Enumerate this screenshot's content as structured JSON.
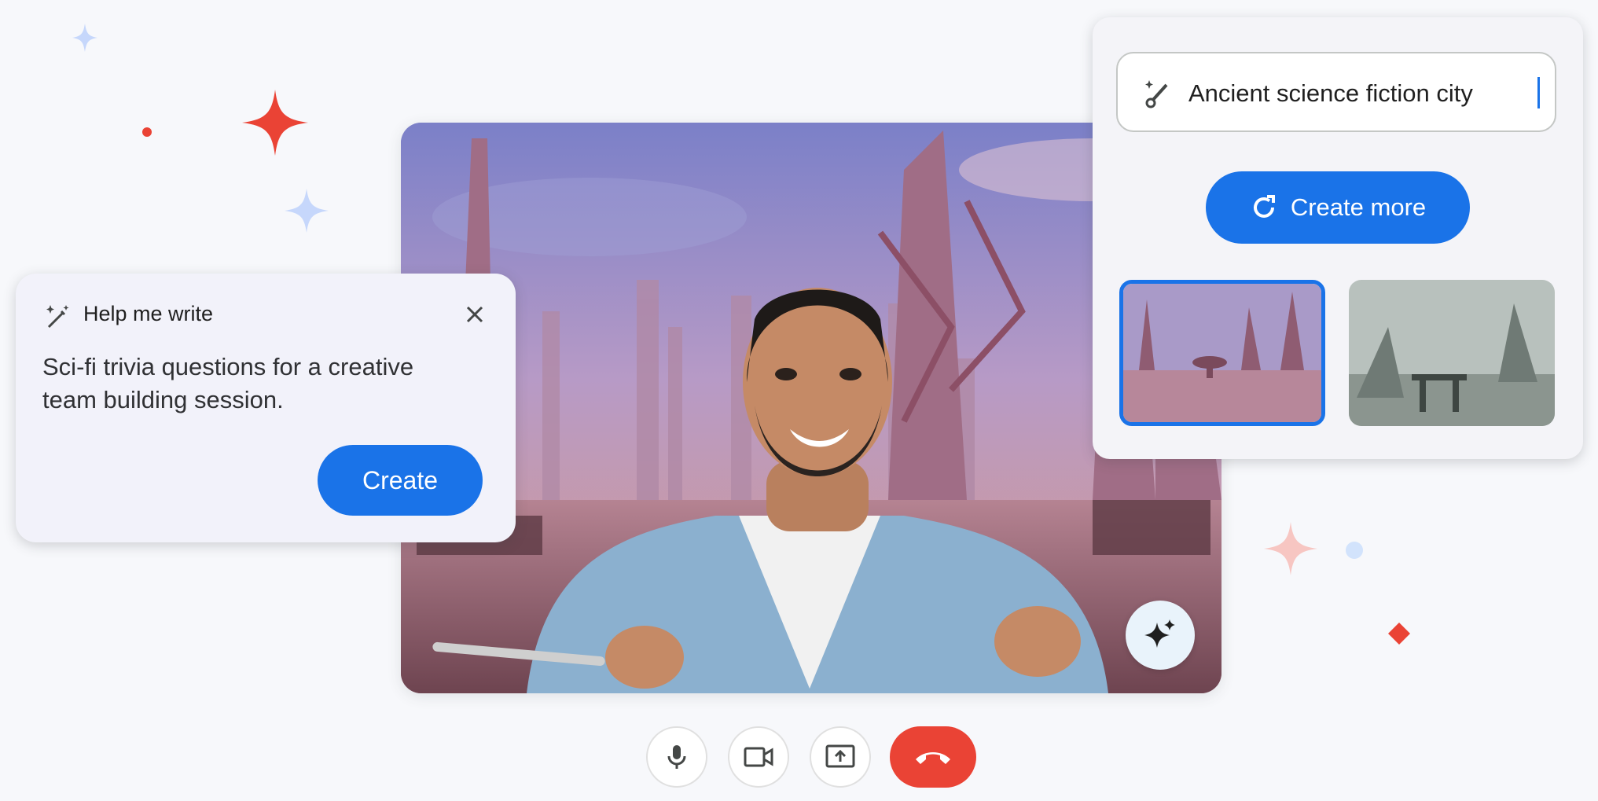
{
  "help_me_write": {
    "title": "Help me write",
    "prompt_text": "Sci-fi trivia questions for a creative team building session.",
    "create_label": "Create",
    "close_icon": "close-icon",
    "header_icon": "magic-pen-icon"
  },
  "generate_background": {
    "prompt_value": "Ancient science fiction city",
    "field_icon": "brush-sparkle-icon",
    "create_more_label": "Create more",
    "refresh_icon": "refresh-icon",
    "thumbnails": [
      {
        "selected": true
      },
      {
        "selected": false
      }
    ]
  },
  "video": {
    "effects_icon": "sparkle-icon"
  },
  "controls": {
    "mic_icon": "mic-icon",
    "camera_icon": "camera-icon",
    "present_icon": "present-screen-icon",
    "hangup_icon": "hang-up-icon"
  },
  "colors": {
    "accent": "#1a73e8",
    "hangup": "#ea4335",
    "sparkle_red": "#ea4335",
    "sparkle_blue": "#aecbfa"
  }
}
